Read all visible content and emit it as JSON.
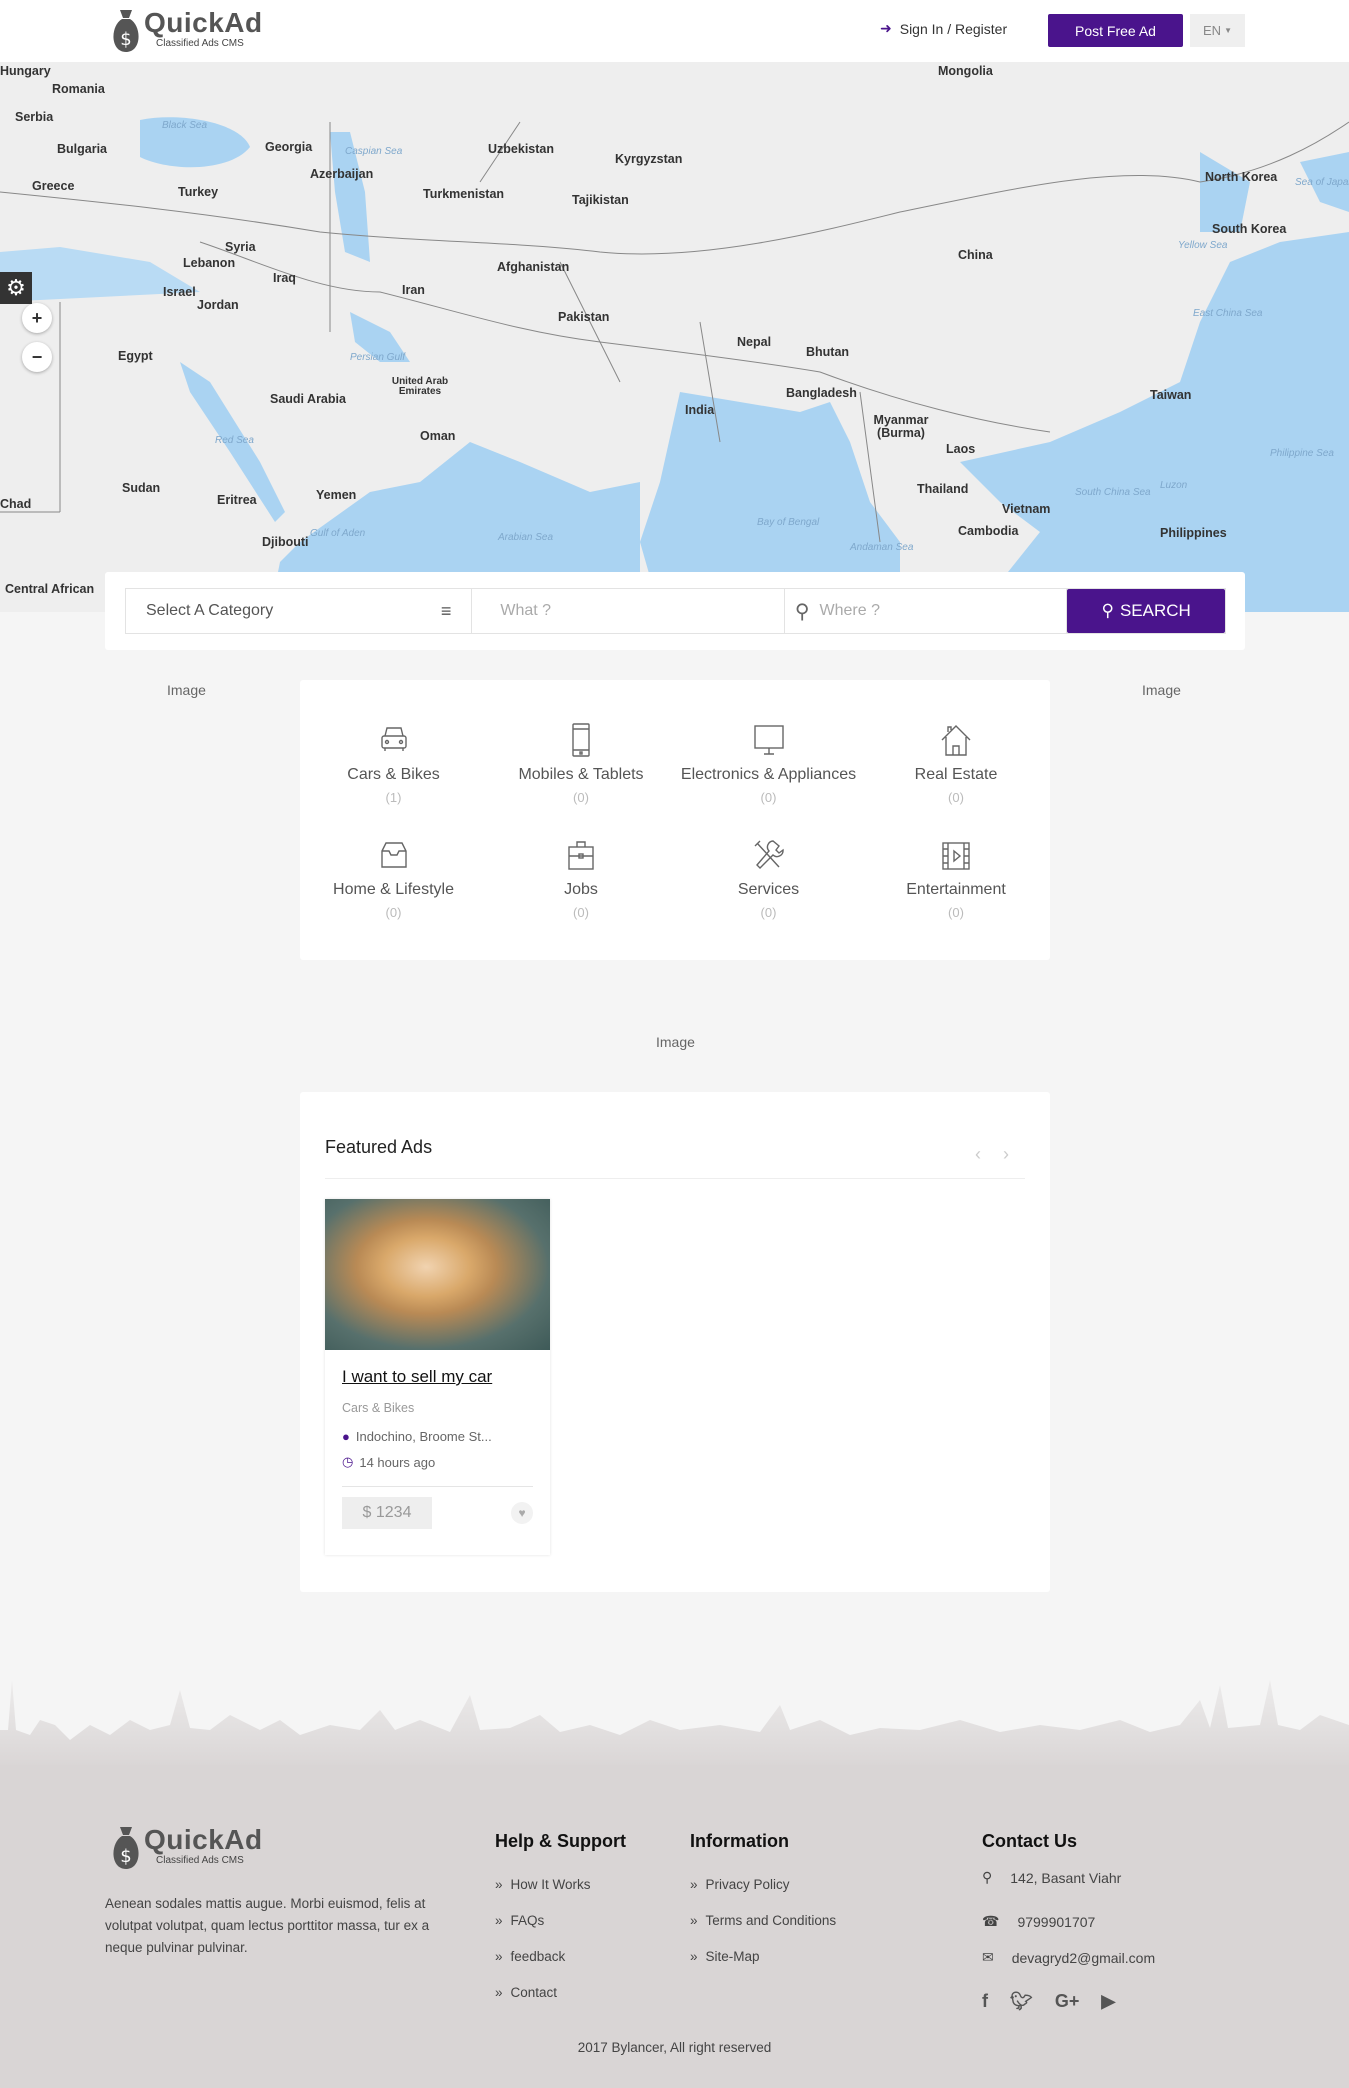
{
  "brand": {
    "name": "QuickAd",
    "tagline": "Classified Ads CMS",
    "accent": "#4a148c"
  },
  "header": {
    "signin": "Sign In / Register",
    "post_ad": "Post Free Ad",
    "language": "EN"
  },
  "map": {
    "labels": [
      "Hungary",
      "Romania",
      "Serbia",
      "Bulgaria",
      "Greece",
      "Turkey",
      "Georgia",
      "Azerbaijan",
      "Uzbekistan",
      "Kyrgyzstan",
      "Turkmenistan",
      "Tajikistan",
      "Mongolia",
      "North Korea",
      "South Korea",
      "China",
      "Syria",
      "Lebanon",
      "Israel",
      "Jordan",
      "Iraq",
      "Iran",
      "Afghanistan",
      "Pakistan",
      "Nepal",
      "Bhutan",
      "Egypt",
      "Saudi Arabia",
      "United Arab Emirates",
      "Oman",
      "India",
      "Bangladesh",
      "Myanmar (Burma)",
      "Taiwan",
      "Laos",
      "Thailand",
      "Vietnam",
      "Cambodia",
      "Philippines",
      "Sudan",
      "Eritrea",
      "Yemen",
      "Djibouti",
      "Chad",
      "Central African"
    ],
    "seas": [
      "Black Sea",
      "Caspian Sea",
      "Persian Gulf",
      "Red Sea",
      "Gulf of Aden",
      "Arabian Sea",
      "Bay of Bengal",
      "Andaman Sea",
      "South China Sea",
      "Philippine Sea",
      "East China Sea",
      "Yellow Sea",
      "Sea of Japan",
      "Luzon"
    ],
    "zoom_in": "+",
    "zoom_out": "−"
  },
  "search": {
    "category_placeholder": "Select A Category",
    "what_placeholder": "What ?",
    "where_placeholder": "Where ?",
    "button": "SEARCH"
  },
  "ad_placeholder": "Image",
  "categories": [
    {
      "name": "Cars & Bikes",
      "count": "(1)",
      "icon": "car-icon"
    },
    {
      "name": "Mobiles & Tablets",
      "count": "(0)",
      "icon": "mobile-icon"
    },
    {
      "name": "Electronics & Appliances",
      "count": "(0)",
      "icon": "monitor-icon"
    },
    {
      "name": "Real Estate",
      "count": "(0)",
      "icon": "house-icon"
    },
    {
      "name": "Home & Lifestyle",
      "count": "(0)",
      "icon": "inbox-icon"
    },
    {
      "name": "Jobs",
      "count": "(0)",
      "icon": "briefcase-icon"
    },
    {
      "name": "Services",
      "count": "(0)",
      "icon": "tools-icon"
    },
    {
      "name": "Entertainment",
      "count": "(0)",
      "icon": "film-icon"
    }
  ],
  "featured": {
    "title": "Featured Ads",
    "ads": [
      {
        "title": "I want to sell my car",
        "category": "Cars & Bikes",
        "location": "Indochino, Broome St...",
        "time": "14 hours ago",
        "price": "$ 1234"
      }
    ]
  },
  "footer": {
    "about": "Aenean sodales mattis augue. Morbi euismod, felis at volutpat volutpat, quam lectus porttitor massa, tur ex a neque pulvinar pulvinar.",
    "help": {
      "title": "Help & Support",
      "links": [
        "How It Works",
        "FAQs",
        "feedback",
        "Contact"
      ]
    },
    "info": {
      "title": "Information",
      "links": [
        "Privacy Policy",
        "Terms and Conditions",
        "Site-Map"
      ]
    },
    "contact": {
      "title": "Contact Us",
      "address": "142, Basant Viahr",
      "phone": "9799901707",
      "email": "devagryd2@gmail.com"
    },
    "copyright": "2017 Bylancer, All right reserved"
  }
}
